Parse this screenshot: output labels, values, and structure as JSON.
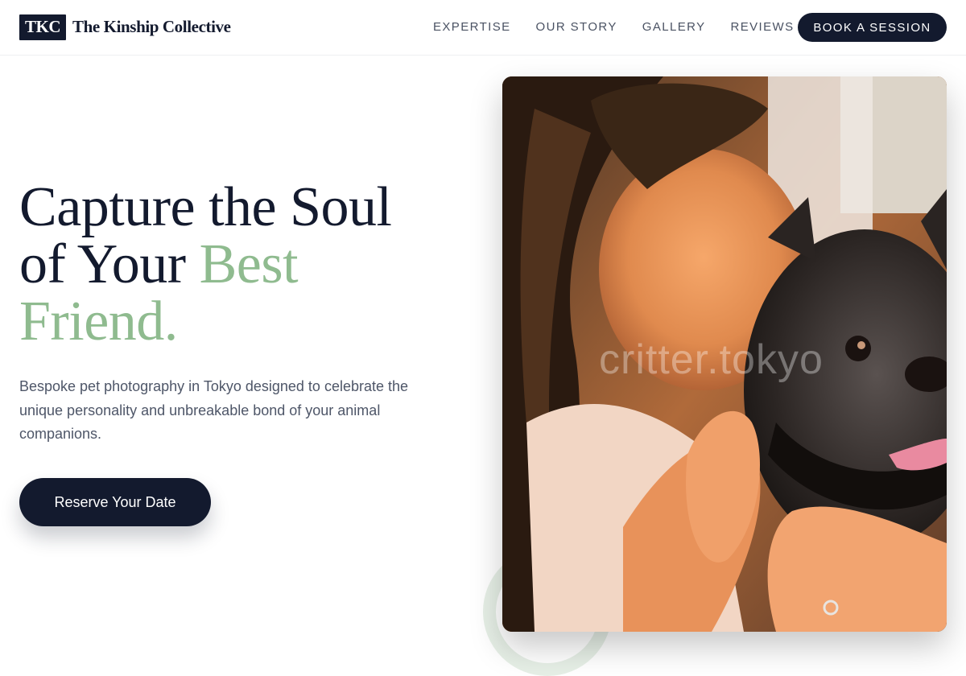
{
  "brand": {
    "mark": "TKC",
    "name": "The Kinship Collective"
  },
  "nav": {
    "items": [
      {
        "label": "EXPERTISE"
      },
      {
        "label": "OUR STORY"
      },
      {
        "label": "GALLERY"
      },
      {
        "label": "REVIEWS"
      }
    ],
    "cta_label": "BOOK A SESSION"
  },
  "hero": {
    "title_line1": "Capture the Soul",
    "title_line2_part1": "of Your ",
    "title_line2_accent": "Best",
    "title_line3_accent": "Friend.",
    "subtitle": "Bespoke pet photography in Tokyo designed to celebrate the unique personality and unbreakable bond of your animal companions.",
    "cta_label": "Reserve Your Date",
    "photo_watermark": "critter.tokyo"
  },
  "colors": {
    "navy": "#131a2e",
    "accent_green": "#8fbb8f",
    "body_text": "#4e5668"
  }
}
